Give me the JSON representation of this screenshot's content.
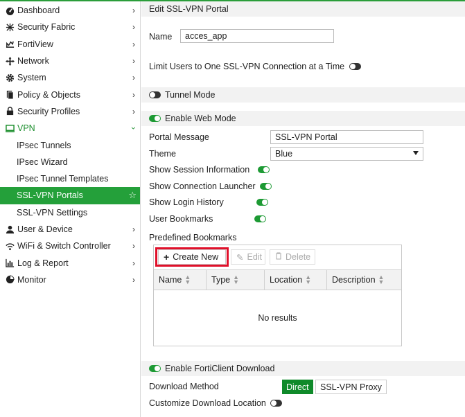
{
  "sidebar": {
    "items": [
      {
        "label": "Dashboard",
        "icon": "dashboard-icon"
      },
      {
        "label": "Security Fabric",
        "icon": "fabric-icon"
      },
      {
        "label": "FortiView",
        "icon": "fortiview-icon"
      },
      {
        "label": "Network",
        "icon": "network-icon"
      },
      {
        "label": "System",
        "icon": "gear-icon"
      },
      {
        "label": "Policy & Objects",
        "icon": "policy-icon"
      },
      {
        "label": "Security Profiles",
        "icon": "lock-icon"
      },
      {
        "label": "VPN",
        "icon": "monitor-icon"
      },
      {
        "label": "IPsec Tunnels"
      },
      {
        "label": "IPsec Wizard"
      },
      {
        "label": "IPsec Tunnel Templates"
      },
      {
        "label": "SSL-VPN Portals"
      },
      {
        "label": "SSL-VPN Settings"
      },
      {
        "label": "User & Device",
        "icon": "user-icon"
      },
      {
        "label": "WiFi & Switch Controller",
        "icon": "wifi-icon"
      },
      {
        "label": "Log & Report",
        "icon": "chart-icon"
      },
      {
        "label": "Monitor",
        "icon": "pie-icon"
      }
    ]
  },
  "page": {
    "title": "Edit SSL-VPN Portal",
    "name_label": "Name",
    "name_value": "acces_app",
    "limit_label": "Limit Users to One SSL-VPN Connection at a Time",
    "tunnel_label": "Tunnel Mode",
    "web_label": "Enable Web Mode",
    "portal_msg_label": "Portal Message",
    "portal_msg_value": "SSL-VPN Portal",
    "theme_label": "Theme",
    "theme_value": "Blue",
    "session_label": "Show Session Information",
    "launcher_label": "Show Connection Launcher",
    "login_label": "Show Login History",
    "bookmarks_label": "User Bookmarks",
    "predefined_label": "Predefined Bookmarks",
    "create_label": "Create New",
    "edit_label": "Edit",
    "delete_label": "Delete",
    "columns": [
      "Name",
      "Type",
      "Location",
      "Description"
    ],
    "no_results": "No results",
    "forticlient_label": "Enable FortiClient Download",
    "download_label": "Download Method",
    "direct_label": "Direct",
    "proxy_label": "SSL-VPN Proxy",
    "custom_loc_label": "Customize Download Location"
  },
  "colors": {
    "accent": "#24a03a",
    "highlight": "#e0102a"
  }
}
